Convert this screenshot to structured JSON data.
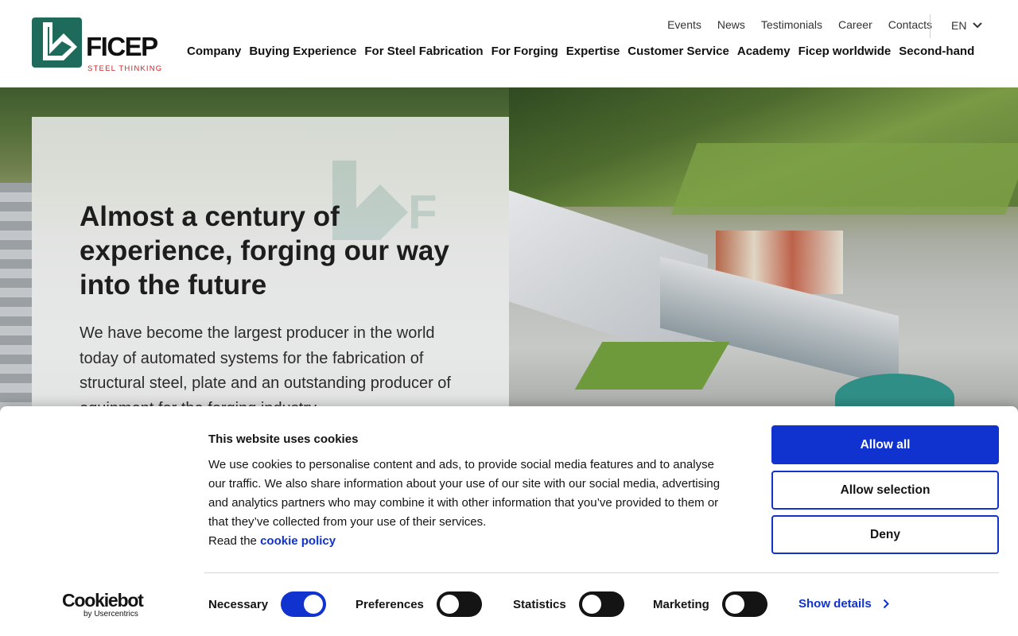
{
  "brand": {
    "name": "FICEP",
    "tagline": "STEEL THINKING",
    "colors": {
      "green": "#1e6b5c",
      "red": "#d21f26",
      "blue": "#1032cf"
    }
  },
  "topnav": {
    "items": [
      "Events",
      "News",
      "Testimonials",
      "Career",
      "Contacts"
    ],
    "language": "EN"
  },
  "mainnav": {
    "items": [
      "Company",
      "Buying Experience",
      "For Steel Fabrication",
      "For Forging",
      "Expertise",
      "Customer Service",
      "Academy",
      "Ficep worldwide",
      "Second-hand"
    ]
  },
  "hero": {
    "title": "Almost a century of experience, forging our way into the future",
    "text": "We have become the largest producer in the world today of automated systems for the fabrication of structural steel, plate and an outstanding producer of equipment for the forging industry"
  },
  "cookie": {
    "title": "This website uses cookies",
    "body": "We use cookies to personalise content and ads, to provide social media features and to analyse our traffic. We also share information about your use of our site with our social media, advertising and analytics partners who may combine it with other information that you’ve provided to them or that they’ve collected from your use of their services.",
    "read_prefix": "Read the",
    "policy_link": "cookie policy",
    "buttons": {
      "allow_all": "Allow all",
      "allow_selection": "Allow selection",
      "deny": "Deny"
    },
    "toggles": [
      {
        "label": "Necessary",
        "state": "on"
      },
      {
        "label": "Preferences",
        "state": "off"
      },
      {
        "label": "Statistics",
        "state": "off"
      },
      {
        "label": "Marketing",
        "state": "off"
      }
    ],
    "show_details": "Show details",
    "provider": {
      "name": "Cookiebot",
      "by": "by Usercentrics"
    }
  }
}
